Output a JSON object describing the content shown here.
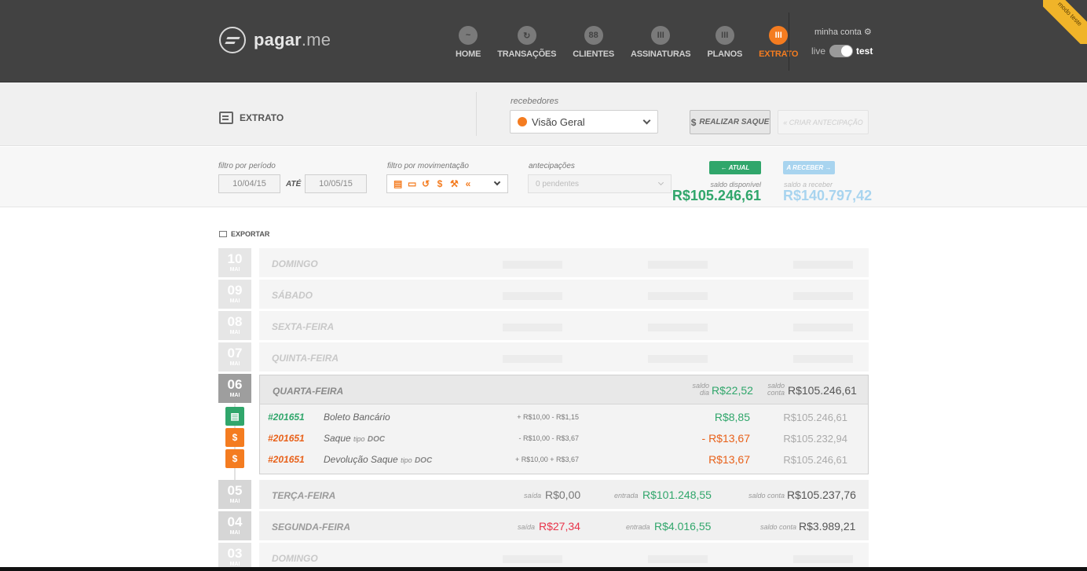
{
  "brand": {
    "name_bold": "pagar",
    "name_rest": ".me"
  },
  "nav": [
    {
      "label": "HOME",
      "icon": "chart-icon",
      "glyph": "~"
    },
    {
      "label": "TRANSAÇÕES",
      "icon": "refresh-icon",
      "glyph": "↻"
    },
    {
      "label": "CLIENTES",
      "icon": "users-icon",
      "glyph": "88"
    },
    {
      "label": "ASSINATURAS",
      "icon": "subscriptions-icon",
      "glyph": "III"
    },
    {
      "label": "PLANOS",
      "icon": "plans-icon",
      "glyph": "III"
    },
    {
      "label": "EXTRATO",
      "icon": "statement-icon",
      "glyph": "III",
      "active": true
    }
  ],
  "account": {
    "label": "minha conta",
    "mode_live": "live",
    "mode_test": "test",
    "ribbon": "modo teste"
  },
  "page": {
    "title": "EXTRATO"
  },
  "recebedores": {
    "label": "recebedores",
    "selected": "Visão Geral"
  },
  "buttons": {
    "saque": "REALIZAR SAQUE",
    "antecipacao": "« CRIAR ANTECIPAÇÃO"
  },
  "filters": {
    "periodo_label": "filtro por período",
    "date_from": "10/04/15",
    "ate": "ATÉ",
    "date_to": "10/05/15",
    "movimentacao_label": "filtro por movimentação",
    "antecipacoes_label": "antecipações",
    "antecipacoes_value": "0 pendentes"
  },
  "saldo": {
    "atual_label": "← ATUAL",
    "receber_label": "A RECEBER →",
    "disponivel_label": "saldo disponível",
    "disponivel": "R$105.246,61",
    "a_receber_label": "saldo a receber",
    "a_receber": "R$140.797,42"
  },
  "exportar": "EXPORTAR",
  "days": [
    {
      "day": "10",
      "month": "MAI",
      "weekday": "DOMINGO"
    },
    {
      "day": "09",
      "month": "MAI",
      "weekday": "SÁBADO"
    },
    {
      "day": "08",
      "month": "MAI",
      "weekday": "SEXTA-FEIRA"
    },
    {
      "day": "07",
      "month": "MAI",
      "weekday": "QUINTA-FEIRA"
    }
  ],
  "active_day": {
    "day": "06",
    "month": "MAI",
    "weekday": "QUARTA-FEIRA",
    "saldo_dia_label": "saldo dia",
    "saldo_dia": "R$22,52",
    "saldo_conta_label": "saldo conta",
    "saldo_conta": "R$105.246,61",
    "transactions": [
      {
        "id": "#201651",
        "desc": "Boleto Bancário",
        "tipo_label": "",
        "tipo": "",
        "calc": "+ R$10,00 - R$1,15",
        "value": "R$8,85",
        "balance": "R$105.246,61"
      },
      {
        "id": "#201651",
        "desc": "Saque",
        "tipo_label": "tipo",
        "tipo": "DOC",
        "calc": "- R$10,00 - R$3,67",
        "value": "- R$13,67",
        "balance": "R$105.232,94"
      },
      {
        "id": "#201651",
        "desc": "Devolução Saque",
        "tipo_label": "tipo",
        "tipo": "DOC",
        "calc": "+ R$10,00 + R$3,67",
        "value": "R$13,67",
        "balance": "R$105.246,61"
      }
    ]
  },
  "summary_days": [
    {
      "day": "05",
      "month": "MAI",
      "weekday": "TERÇA-FEIRA",
      "saida_label": "saída",
      "saida": "R$0,00",
      "entrada_label": "entrada",
      "entrada": "R$101.248,55",
      "conta_label": "saldo conta",
      "conta": "R$105.237,76"
    },
    {
      "day": "04",
      "month": "MAI",
      "weekday": "SEGUNDA-FEIRA",
      "saida_label": "saída",
      "saida": "R$27,34",
      "entrada_label": "entrada",
      "entrada": "R$4.016,55",
      "conta_label": "saldo conta",
      "conta": "R$3.989,21"
    }
  ],
  "last_day": {
    "day": "03",
    "month": "MAI",
    "weekday": "DOMINGO"
  },
  "colors": {
    "accent": "#f47c20",
    "green": "#30a66b",
    "red": "#e8344a",
    "header": "#424242"
  }
}
